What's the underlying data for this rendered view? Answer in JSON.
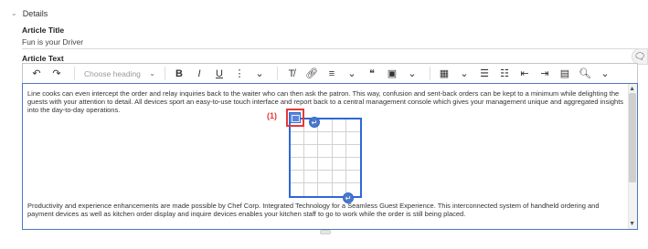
{
  "details": {
    "header": "Details",
    "article_title_label": "Article Title",
    "article_title_value": "Fun is your Driver",
    "article_text_label": "Article Text"
  },
  "toolbar": {
    "undo_icon": "undo-icon",
    "redo_icon": "redo-icon",
    "heading_placeholder": "Choose heading",
    "bold_label": "B",
    "italic_label": "I",
    "underline_label": "U",
    "more_text_icon": "more-text-styles-icon",
    "clear_format_icon": "remove-format-icon",
    "link_icon": "link-icon",
    "align_icon": "align-icon",
    "quote_label": "❝",
    "media_icon": "media-icon",
    "table_icon": "table-icon",
    "bulleted_icon": "bulleted-list-icon",
    "numbered_icon": "numbered-list-icon",
    "outdent_icon": "outdent-icon",
    "indent_icon": "indent-icon",
    "paste_icon": "paste-icon",
    "find_icon": "find-icon"
  },
  "editor": {
    "paragraph_1": "Line cooks can even intercept the order and relay inquiries back to the waiter who can then ask the patron. This way, confusion and sent-back orders can be kept to a minimum while delighting the guests with your attention to detail. All devices sport an easy-to-use touch interface and report back to a central management console which gives your management unique and aggregated insights into the day-to-day operations.",
    "paragraph_2": "Productivity and experience enhancements are made possible by Chef Corp. Integrated Technology for a Seamless Guest Experience. This interconnected system of handheld ordering and payment devices as well as kitchen order display and inquire devices enables your kitchen staff to go to work while the order is still being placed.",
    "marker_label": "(1)"
  },
  "colors": {
    "accent": "#2f67d6",
    "marker": "#e53935"
  }
}
